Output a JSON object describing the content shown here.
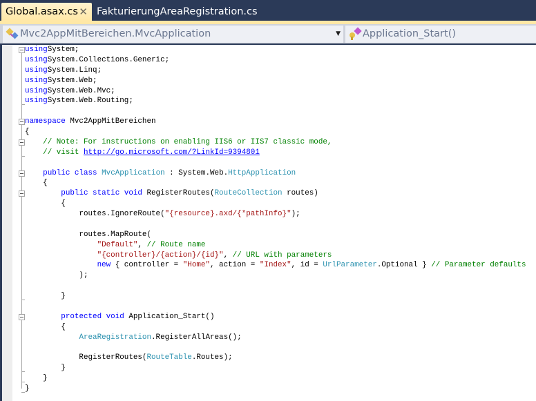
{
  "tabs": [
    {
      "label": "Global.asax.cs",
      "active": true,
      "close": "✕"
    },
    {
      "label": "FakturierungAreaRegistration.cs",
      "active": false
    }
  ],
  "nav": {
    "type_dropdown": {
      "value": "Mvc2AppMitBereichen.MvcApplication",
      "icon": "class-icon"
    },
    "member_dropdown": {
      "value": "Application_Start()",
      "icon": "protected-method-icon"
    },
    "arrow": "▼"
  },
  "colors": {
    "keyword": "#0000ff",
    "type": "#2b91af",
    "string": "#a31515",
    "comment": "#008000",
    "tab_bg": "#2b3a58",
    "active_tab": "#ffe8a6"
  },
  "code": [
    [
      [
        "kw",
        "using"
      ],
      [
        "",
        "System;"
      ]
    ],
    [
      [
        "kw",
        "using"
      ],
      [
        "",
        "System.Collections.Generic;"
      ]
    ],
    [
      [
        "kw",
        "using"
      ],
      [
        "",
        "System.Linq;"
      ]
    ],
    [
      [
        "kw",
        "using"
      ],
      [
        "",
        "System.Web;"
      ]
    ],
    [
      [
        "kw",
        "using"
      ],
      [
        "",
        "System.Web.Mvc;"
      ]
    ],
    [
      [
        "kw",
        "using"
      ],
      [
        "",
        "System.Web.Routing;"
      ]
    ],
    [],
    [
      [
        "kw",
        "namespace"
      ],
      [
        "",
        " Mvc2AppMitBereichen"
      ]
    ],
    [
      [
        "",
        "{"
      ]
    ],
    [
      [
        "",
        "    "
      ],
      [
        "cm",
        "// Note: For instructions on enabling IIS6 or IIS7 classic mode,"
      ]
    ],
    [
      [
        "",
        "    "
      ],
      [
        "cm",
        "// visit "
      ],
      [
        "ln",
        "http://go.microsoft.com/?LinkId=9394801"
      ]
    ],
    [],
    [
      [
        "",
        "    "
      ],
      [
        "kw",
        "public class"
      ],
      [
        "",
        " "
      ],
      [
        "ty",
        "MvcApplication"
      ],
      [
        "",
        " : System.Web."
      ],
      [
        "ty",
        "HttpApplication"
      ]
    ],
    [
      [
        "",
        "    {"
      ]
    ],
    [
      [
        "",
        "        "
      ],
      [
        "kw",
        "public static void"
      ],
      [
        "",
        " RegisterRoutes("
      ],
      [
        "ty",
        "RouteCollection"
      ],
      [
        "",
        " routes)"
      ]
    ],
    [
      [
        "",
        "        {"
      ]
    ],
    [
      [
        "",
        "            routes.IgnoreRoute("
      ],
      [
        "st",
        "\"{resource}.axd/{*pathInfo}\""
      ],
      [
        "",
        ");"
      ]
    ],
    [],
    [
      [
        "",
        "            routes.MapRoute("
      ]
    ],
    [
      [
        "",
        "                "
      ],
      [
        "st",
        "\"Default\""
      ],
      [
        "",
        ", "
      ],
      [
        "cm",
        "// Route name"
      ]
    ],
    [
      [
        "",
        "                "
      ],
      [
        "st",
        "\"{controller}/{action}/{id}\""
      ],
      [
        "",
        ", "
      ],
      [
        "cm",
        "// URL with parameters"
      ]
    ],
    [
      [
        "",
        "                "
      ],
      [
        "kw",
        "new"
      ],
      [
        "",
        " { controller = "
      ],
      [
        "st",
        "\"Home\""
      ],
      [
        "",
        ", action = "
      ],
      [
        "st",
        "\"Index\""
      ],
      [
        "",
        ", id = "
      ],
      [
        "ty",
        "UrlParameter"
      ],
      [
        "",
        ".Optional } "
      ],
      [
        "cm",
        "// Parameter defaults"
      ]
    ],
    [
      [
        "",
        "            );"
      ]
    ],
    [],
    [
      [
        "",
        "        }"
      ]
    ],
    [],
    [
      [
        "",
        "        "
      ],
      [
        "kw",
        "protected void"
      ],
      [
        "",
        " Application_Start()"
      ]
    ],
    [
      [
        "",
        "        {"
      ]
    ],
    [
      [
        "",
        "            "
      ],
      [
        "ty",
        "AreaRegistration"
      ],
      [
        "",
        ".RegisterAllAreas();"
      ]
    ],
    [],
    [
      [
        "",
        "            RegisterRoutes("
      ],
      [
        "ty",
        "RouteTable"
      ],
      [
        "",
        ".Routes);"
      ]
    ],
    [
      [
        "",
        "        }"
      ]
    ],
    [
      [
        "",
        "    }"
      ]
    ],
    [
      [
        "",
        "}"
      ]
    ]
  ]
}
